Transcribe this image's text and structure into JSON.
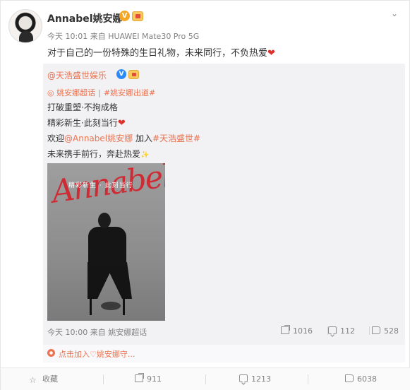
{
  "post": {
    "username": "Annabel姚安娜",
    "verified_badge": "V",
    "time_source": "今天 10:01 来自 HUAWEI Mate30 Pro 5G",
    "text": "对于自己的一份特殊的生日礼物，未来同行，不负热爱",
    "menu_icon": "chevron-down-icon"
  },
  "quoted": {
    "author": "@天浩盛世娱乐",
    "verified_badge": "V",
    "topic_super": "姚安娜超话",
    "topic_tag": "#姚安娜出道#",
    "line1": "打破重塑·不拘成格",
    "line2": "精彩新生·此刻当行",
    "line3_prefix": "欢迎",
    "line3_mention": "@Annabel姚安娜",
    "line3_mid": " 加入",
    "line3_tag": "#天浩盛世#",
    "line4": "未来携手前行，奔赴热爱",
    "image": {
      "script_text": "Annabel",
      "tagline": "精彩新生 · 此刻当行"
    },
    "footer_time": "今天 10:00 来自 姚安娜超话",
    "stats": {
      "reposts": "1016",
      "comments": "112",
      "likes": "528"
    }
  },
  "supertopic_link": "点击加入♡姚安娜守...",
  "actions": {
    "favorite": "收藏",
    "reposts": "911",
    "comments": "1213",
    "likes": "6038"
  },
  "colors": {
    "link": "#eb7350",
    "heart": "#e0322c",
    "quote_bg": "#f2f2f5"
  }
}
